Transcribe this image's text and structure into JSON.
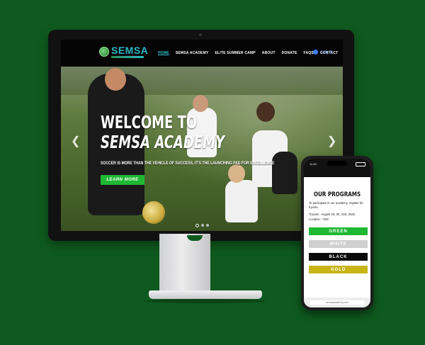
{
  "colors": {
    "background": "#0e5a1e",
    "accent_teal": "#2ec4d0",
    "button_green": "#1fb833",
    "login_blue": "#6ea8ff"
  },
  "desktop": {
    "logo": {
      "text": "SEMSA",
      "icon": "soccer-ball-icon"
    },
    "nav": {
      "items": [
        "HOME",
        "SEMSA ACADEMY",
        "ELITE SUMMER CAMP",
        "ABOUT",
        "DONATE",
        "FAQS",
        "CONTACT"
      ],
      "active_index": 0,
      "login_label": "Log In",
      "login_icon": "user-icon"
    },
    "hero": {
      "title_line1": "WELCOME TO",
      "title_line2": "SEMSA ACADEMY",
      "tagline": "SOCCER IS MORE THAN THE VEHICLE OF SUCCESS, IT'S THE LAUNCHING PAD FOR EXCELLENCE",
      "cta_label": "LEARN MORE",
      "prev_icon": "chevron-left-icon",
      "next_icon": "chevron-right-icon",
      "slide_count": 3,
      "active_slide": 1
    }
  },
  "phone": {
    "status_time": "11:20",
    "title": "OUR PROGRAMS",
    "intro": "To participate in our academy, register for tryouts.",
    "tryouts": "Tryouts - August 29, 30, 31st, 2025",
    "location": "Location - TBD",
    "programs": [
      {
        "label": "GREEN",
        "bg": "#1fb833",
        "fg": "#ffffff"
      },
      {
        "label": "WHITE",
        "bg": "#cfcfcf",
        "fg": "#ffffff"
      },
      {
        "label": "BLACK",
        "bg": "#0a0a0a",
        "fg": "#ffffff"
      },
      {
        "label": "GOLD",
        "bg": "#c8b416",
        "fg": "#ffffff"
      }
    ],
    "url": "semsaacademy.com"
  }
}
